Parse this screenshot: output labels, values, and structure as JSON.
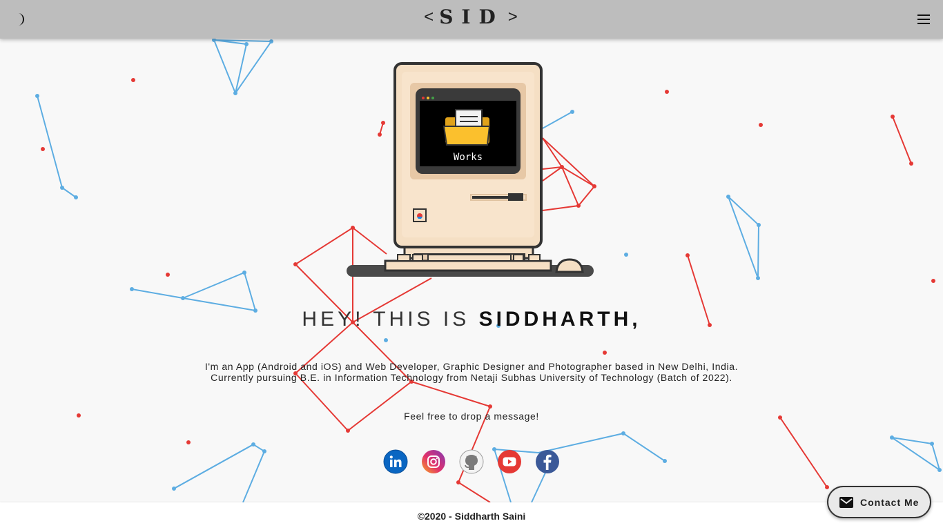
{
  "header": {
    "logo_left": "<",
    "logo_name": "SID",
    "logo_right": ">",
    "theme_icon": "moon-icon",
    "menu_icon": "hamburger-menu-icon"
  },
  "hero": {
    "screen_label": "Works",
    "title_plain": "HEY! THIS IS ",
    "title_name": "SIDDHARTH,",
    "description_line1": "I'm an App (Android and iOS) and Web Developer, Graphic Designer and Photographer based in New Delhi, India.",
    "description_line2": "Currently pursuing B.E. in Information Technology from Netaji Subhas University of Technology (Batch of 2022).",
    "message": "Feel free to drop a message!"
  },
  "socials": [
    {
      "name": "linkedin-icon",
      "color": "#0a66c2"
    },
    {
      "name": "instagram-icon",
      "color": "#c13584"
    },
    {
      "name": "github-icon",
      "color": "#8a8a8a"
    },
    {
      "name": "youtube-icon",
      "color": "#e53935"
    },
    {
      "name": "facebook-icon",
      "color": "#3b5998"
    }
  ],
  "footer": {
    "copyright": "©2020 - Siddharth Saini"
  },
  "contact_button": {
    "label": "Contact Me",
    "icon": "mail-icon"
  },
  "colors": {
    "topbar": "#bdbdbd",
    "background": "#f8f8f8",
    "particle_red": "#e53935",
    "particle_blue": "#5dade2"
  }
}
